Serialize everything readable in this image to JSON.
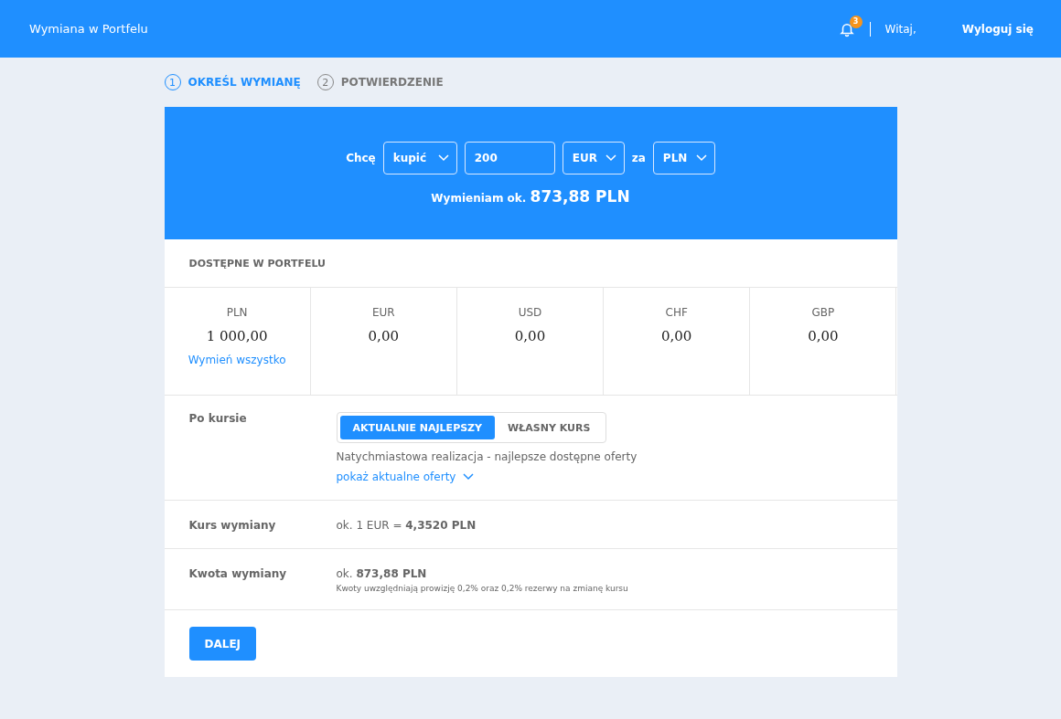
{
  "header": {
    "title": "Wymiana w Portfelu",
    "notifications": "3",
    "greeting": "Witaj,",
    "logout": "Wyloguj się"
  },
  "steps": [
    {
      "number": "1",
      "label": "OKREŚL WYMIANĘ",
      "selected": true
    },
    {
      "number": "2",
      "label": "POTWIERDZENIE",
      "selected": false
    }
  ],
  "exchange": {
    "prefix": "Chcę",
    "action": "kupić",
    "amount": "200",
    "currency": "EUR",
    "joiner": "za",
    "pay_currency": "PLN",
    "summary": "Wymieniam ok. **873,88 PLN**"
  },
  "wallet": {
    "title": "DOSTĘPNE W PORTFELU",
    "balances": [
      {
        "currency": "PLN",
        "amount": "1 000,00",
        "link": "Wymień wszystko"
      },
      {
        "currency": "EUR",
        "amount": "0,00"
      },
      {
        "currency": "USD",
        "amount": "0,00"
      },
      {
        "currency": "CHF",
        "amount": "0,00"
      },
      {
        "currency": "GBP",
        "amount": "0,00"
      }
    ]
  },
  "rate": {
    "label": "Po kursie",
    "options": [
      {
        "label": "AKTUALNIE NAJLEPSZY",
        "selected": true
      },
      {
        "label": "WŁASNY KURS",
        "selected": false
      }
    ],
    "description": "Natychmiastowa realizacja - najlepsze dostępne oferty",
    "offers_link": "pokaż aktualne oferty"
  },
  "rows": [
    {
      "label": "Kurs wymiany",
      "value": "ok. 1 EUR = **4,3520 PLN**"
    },
    {
      "label": "Kwota wymiany",
      "value": "ok. **873,88 PLN**",
      "note": "Kwoty uwzględniają prowizję 0,2% oraz 0,2% rezerwy na zmianę kursu"
    }
  ],
  "next_button": "DALEJ"
}
